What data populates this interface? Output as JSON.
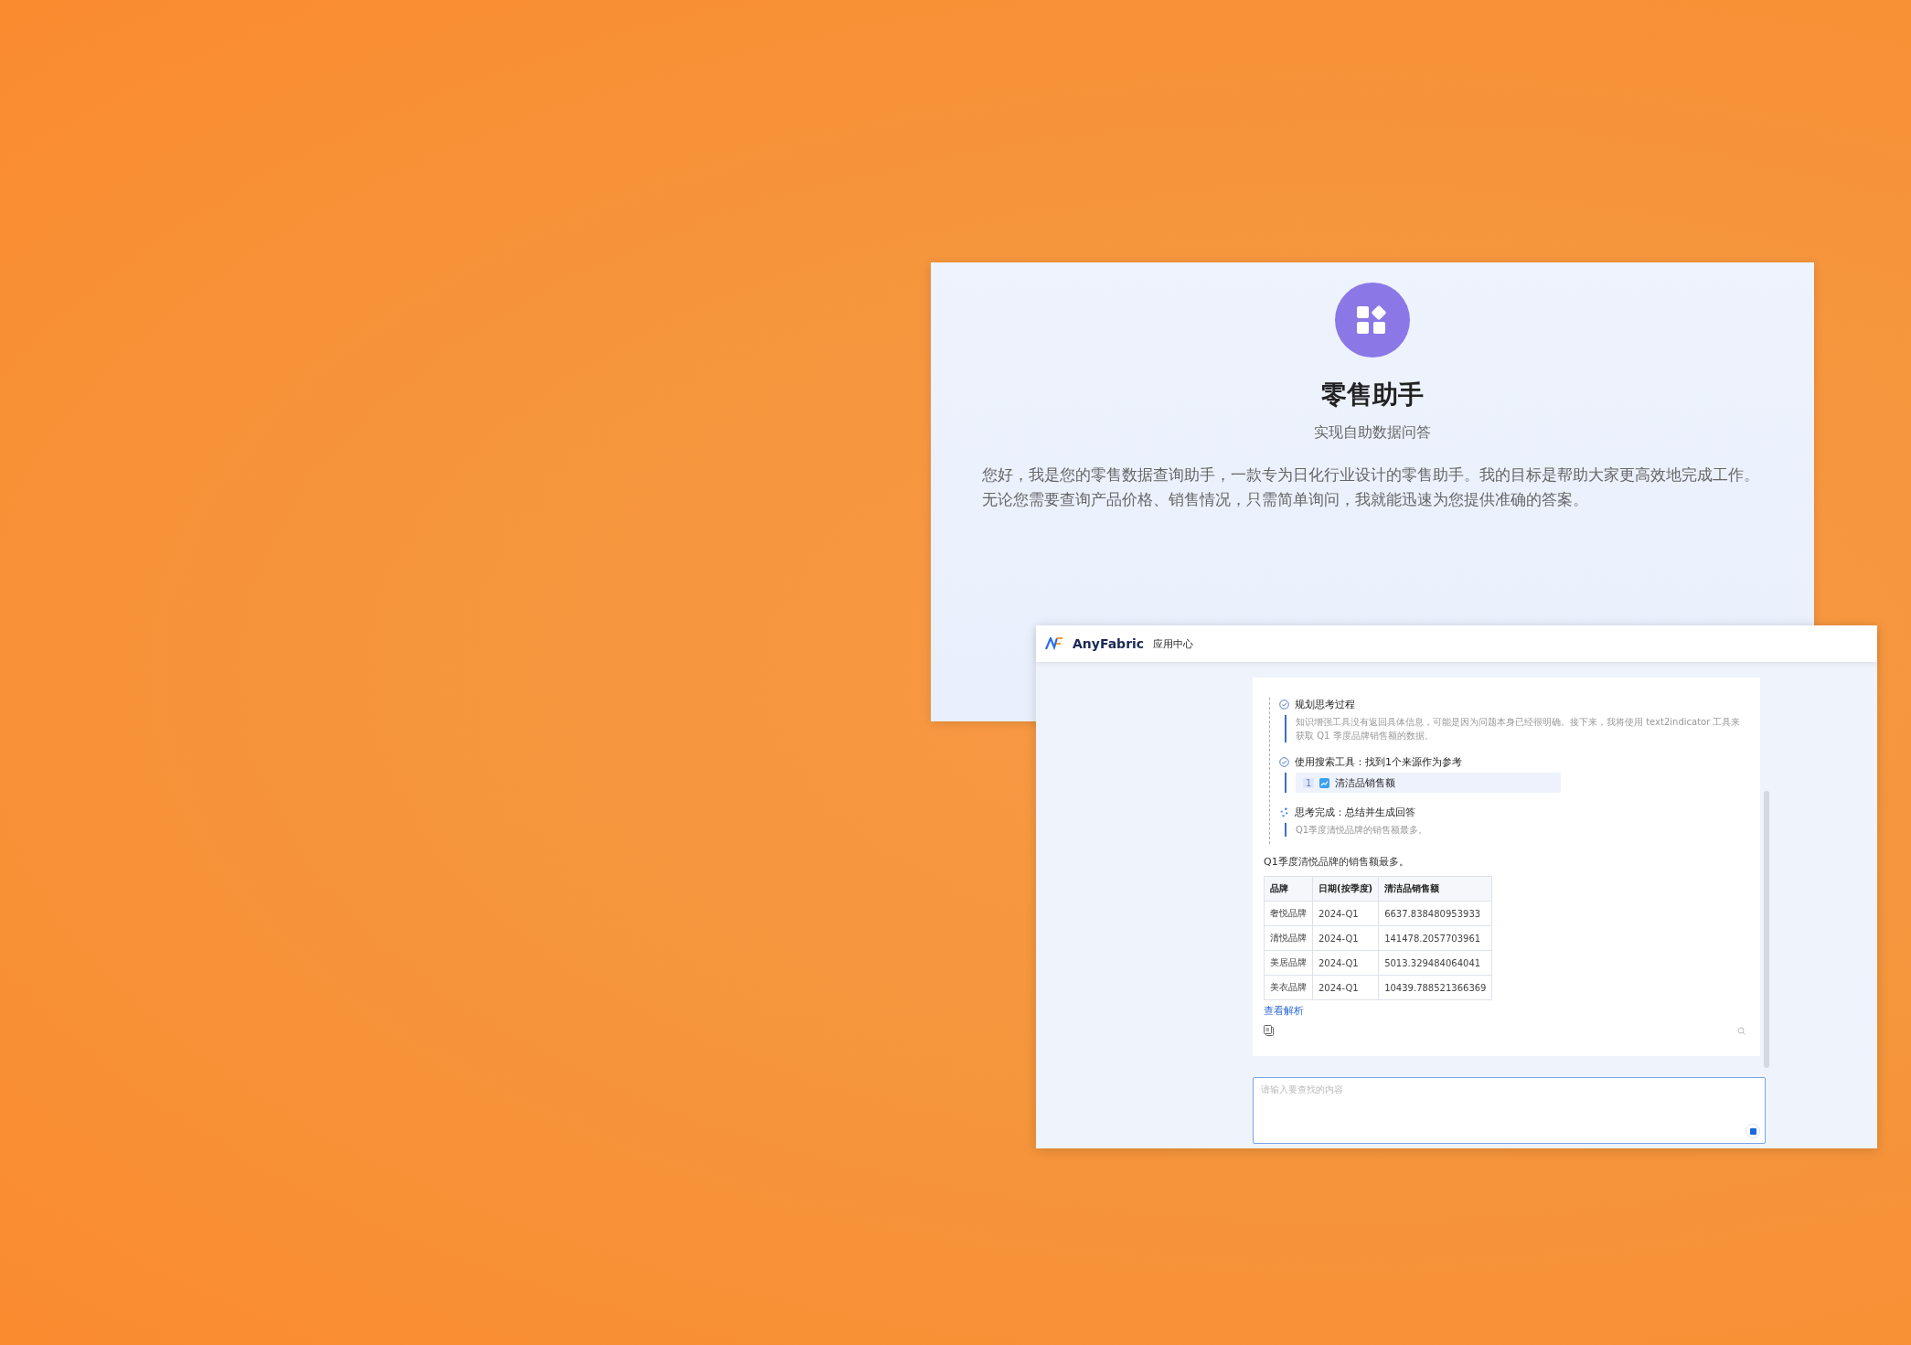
{
  "assistant_card": {
    "title": "零售助手",
    "subtitle": "实现自助数据问答",
    "intro_lines": [
      "您好，我是您的零售数据查询助手，一款专为日化行业设计的零售助手。我的目标是帮助大家更高效地完成工作。",
      "无论您需要查询产品价格、销售情况，只需简单询问，我就能迅速为您提供准确的答案。"
    ]
  },
  "app_window": {
    "brand": "AnyFabric",
    "nav": "应用中心",
    "steps": [
      {
        "kind": "done",
        "title": "规划思考过程",
        "detail": "知识增强工具没有返回具体信息，可能是因为问题本身已经很明确。接下来，我将使用 text2indicator 工具来获取 Q1 季度品牌销售额的数据。"
      },
      {
        "kind": "done",
        "title": "使用搜索工具：找到1个来源作为参考",
        "sources": [
          {
            "index": "1",
            "name": "清洁品销售额"
          }
        ]
      },
      {
        "kind": "finished",
        "title": "思考完成：总结并生成回答",
        "detail": "Q1季度清悦品牌的销售额最多。"
      }
    ],
    "answer": "Q1季度清悦品牌的销售额最多。",
    "table": {
      "columns": [
        "品牌",
        "日期(按季度)",
        "清洁品销售额"
      ],
      "rows": [
        [
          "奢悦品牌",
          "2024-Q1",
          "6637.838480953933"
        ],
        [
          "清悦品牌",
          "2024-Q1",
          "141478.2057703961"
        ],
        [
          "美居品牌",
          "2024-Q1",
          "5013.329484064041"
        ],
        [
          "美衣品牌",
          "2024-Q1",
          "10439.788521366369"
        ]
      ]
    },
    "link": "查看解析",
    "input": {
      "placeholder": "请输入要查找的内容"
    }
  }
}
